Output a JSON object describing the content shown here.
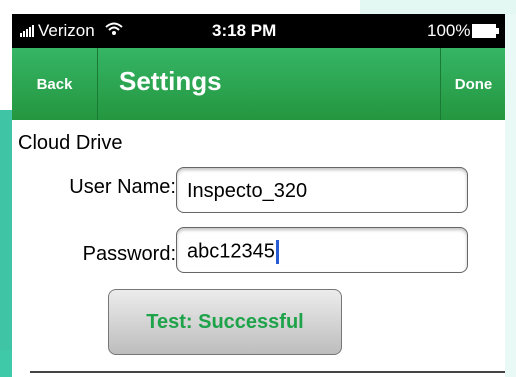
{
  "status": {
    "carrier": "Verizon",
    "time": "3:18 PM",
    "battery": "100%"
  },
  "nav": {
    "back_label": "Back",
    "title": "Settings",
    "done_label": "Done"
  },
  "section": {
    "title": "Cloud Drive"
  },
  "form": {
    "username_label": "User Name:",
    "username_value": "Inspecto_320",
    "password_label": "Password:",
    "password_value": "abc12345"
  },
  "test_button": {
    "label": "Test: Successful"
  },
  "colors": {
    "nav_green": "#2aa34f",
    "accent_green": "#1ea34a",
    "caret_blue": "#2a5bd7",
    "background_teal": "#3fc4a6"
  },
  "icons": [
    "signal-bars-icon",
    "wifi-icon",
    "battery-icon"
  ]
}
